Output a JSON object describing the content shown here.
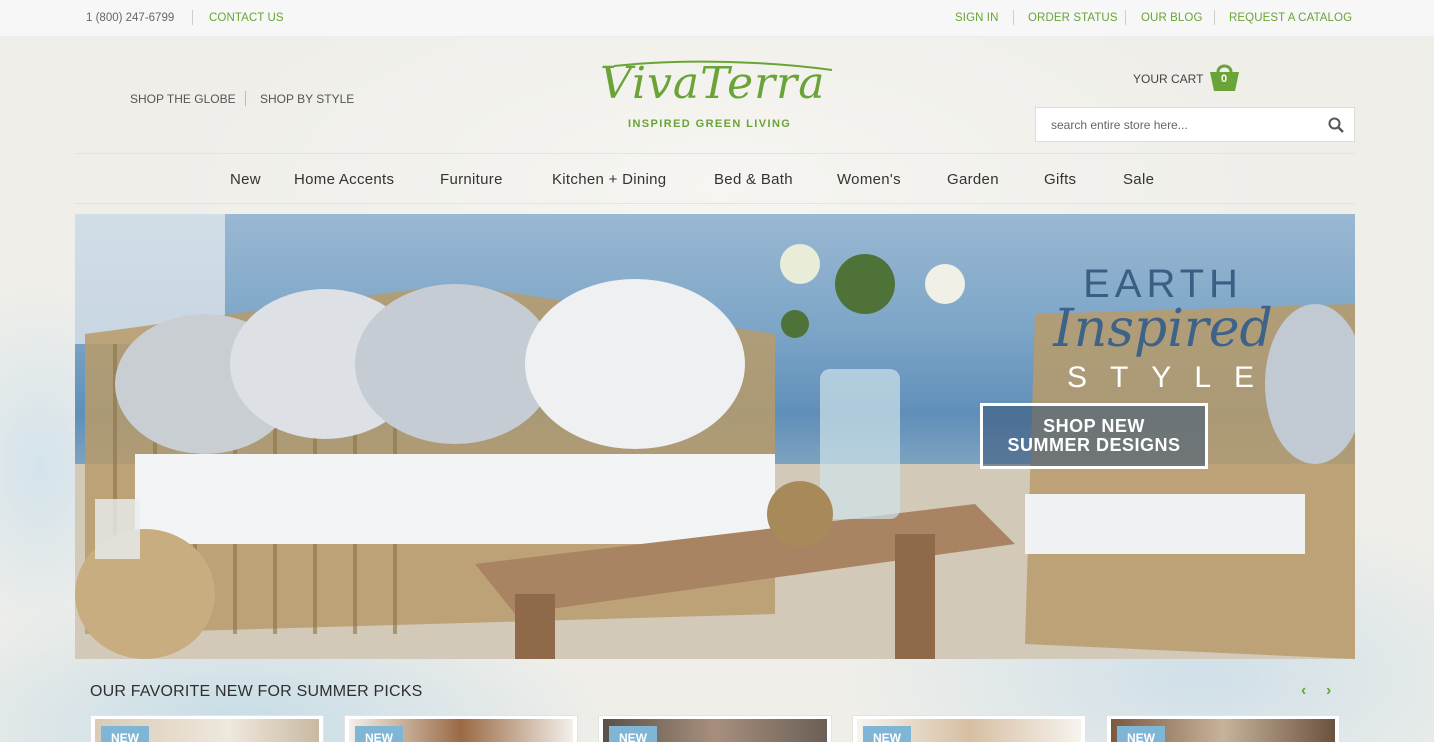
{
  "topbar": {
    "phone": "1 (800) 247-6799",
    "contact": "CONTACT US",
    "sign_in": "SIGN IN",
    "order_status": "ORDER STATUS",
    "our_blog": "OUR BLOG",
    "request_catalog": "REQUEST A CATALOG"
  },
  "header": {
    "shop_globe": "SHOP THE GLOBE",
    "shop_style": "SHOP BY STYLE",
    "logo_script": "VivaTerra",
    "logo_tagline": "INSPIRED GREEN LIVING",
    "cart_label": "YOUR CART",
    "cart_count": "0",
    "search_placeholder": "search entire store here..."
  },
  "nav": {
    "items": [
      "New",
      "Home Accents",
      "Furniture",
      "Kitchen + Dining",
      "Bed & Bath",
      "Women's",
      "Garden",
      "Gifts",
      "Sale"
    ]
  },
  "hero": {
    "line1": "EARTH",
    "line2": "Inspired",
    "line3": "STYLE",
    "cta_line1": "SHOP NEW",
    "cta_line2": "SUMMER DESIGNS"
  },
  "picks": {
    "title": "OUR FAVORITE NEW FOR SUMMER PICKS",
    "badges": [
      "NEW",
      "NEW",
      "NEW",
      "NEW",
      "NEW"
    ]
  },
  "colors": {
    "brand_green": "#6aa337",
    "hero_blue": "#3b5f84",
    "badge_blue": "#7fb6d6"
  },
  "icons": {
    "cart": "basket-icon",
    "search": "search-icon",
    "prev": "chevron-left-icon",
    "next": "chevron-right-icon"
  }
}
